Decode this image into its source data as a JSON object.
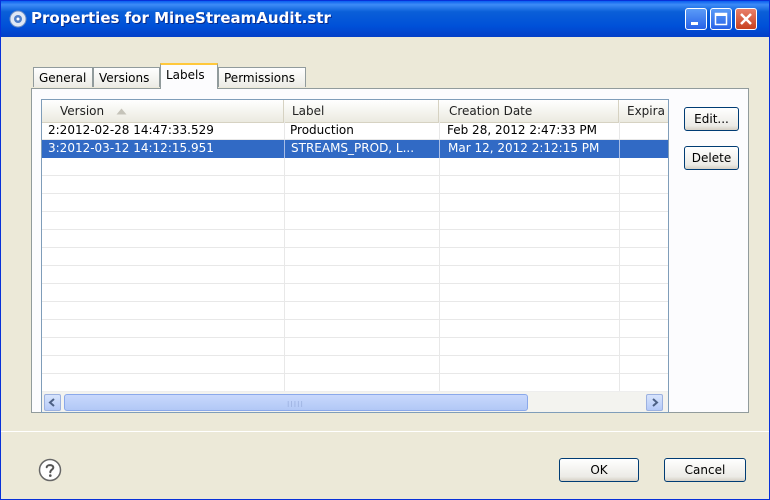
{
  "window": {
    "title": "Properties for MineStreamAudit.str"
  },
  "tabs": [
    {
      "label": "General",
      "selected": false
    },
    {
      "label": "Versions",
      "selected": false
    },
    {
      "label": "Labels",
      "selected": true
    },
    {
      "label": "Permissions",
      "selected": false
    }
  ],
  "table": {
    "columns": [
      {
        "label": "Version",
        "sorted": "ascending"
      },
      {
        "label": "Label"
      },
      {
        "label": "Creation Date"
      },
      {
        "label": "Expira"
      }
    ],
    "rows": [
      {
        "version": "2:2012-02-28 14:47:33.529",
        "label": "Production",
        "created": "Feb 28, 2012 2:47:33 PM",
        "expires": "",
        "selected": false
      },
      {
        "version": "3:2012-03-12 14:12:15.951",
        "label": "STREAMS_PROD, L...",
        "created": "Mar 12, 2012 2:12:15 PM",
        "expires": "",
        "selected": true
      }
    ],
    "scrollbar_grip": "IIIII"
  },
  "side_buttons": {
    "edit": "Edit...",
    "delete": "Delete"
  },
  "footer": {
    "ok": "OK",
    "cancel": "Cancel"
  },
  "colors": {
    "title_bar": "#0050d8",
    "selection": "#316ac5",
    "dialog_bg": "#ece9d8",
    "active_tab_highlight": "#ffc83c"
  }
}
